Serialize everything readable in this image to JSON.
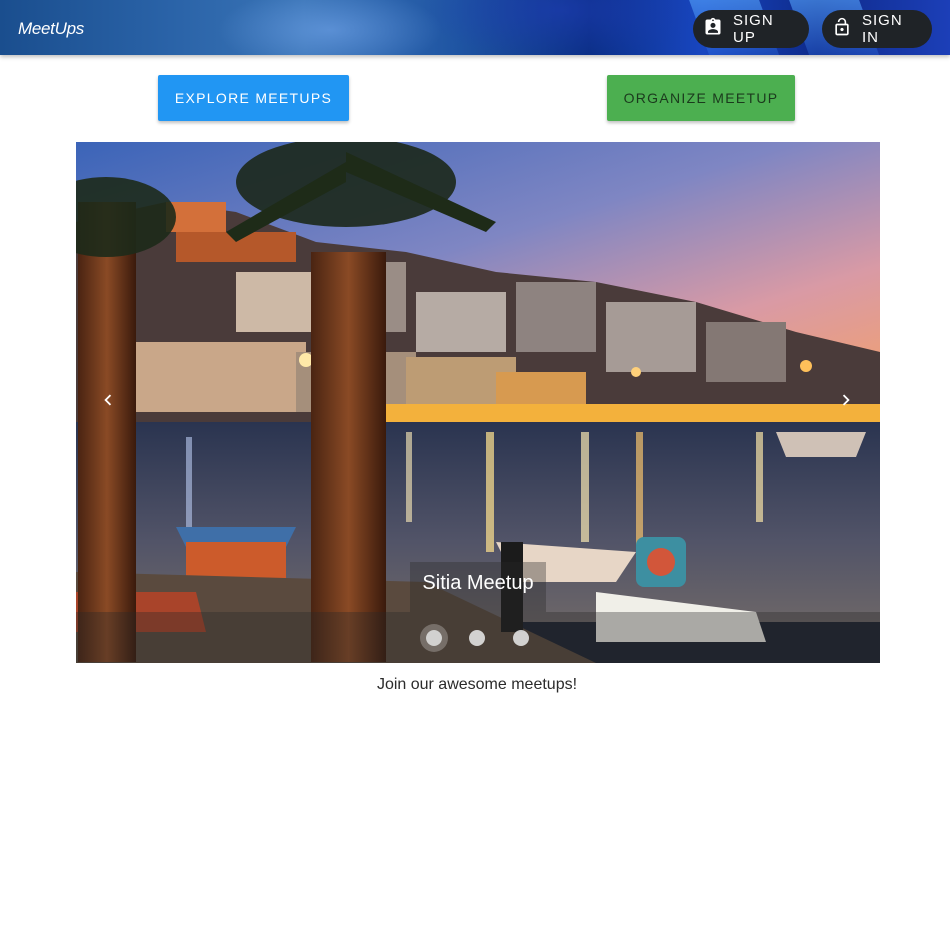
{
  "app": {
    "title": "MeetUps"
  },
  "nav": {
    "signup_label": "SIGN UP",
    "signin_label": "SIGN IN"
  },
  "actions": {
    "explore_label": "EXPLORE MEETUPS",
    "organize_label": "ORGANIZE MEETUP"
  },
  "carousel": {
    "caption": "Sitia Meetup",
    "slides_count": 3,
    "active_slide": 1
  },
  "tagline": "Join our awesome meetups!",
  "icons": {
    "signup": "account-box-icon",
    "signin": "lock-open-icon",
    "prev": "chevron-left-icon",
    "next": "chevron-right-icon"
  },
  "colors": {
    "explore": "#2196f3",
    "organize": "#4caf50",
    "nav_button": "#1f2327"
  }
}
